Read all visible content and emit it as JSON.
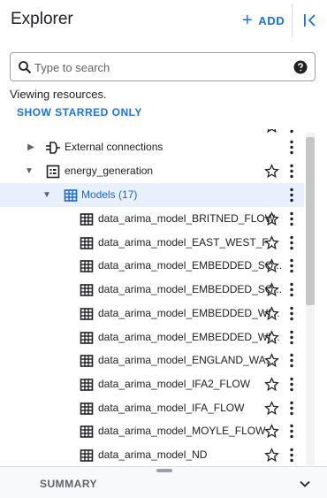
{
  "header": {
    "title": "Explorer",
    "add_label": "ADD"
  },
  "search": {
    "placeholder": "Type to search",
    "value": ""
  },
  "status_text": "Viewing resources.",
  "show_starred_label": "SHOW STARRED ONLY",
  "tree": {
    "external_connections": {
      "label": "External connections"
    },
    "dataset": {
      "label": "energy_generation"
    },
    "models_group": {
      "label": "Models (17)"
    },
    "models": [
      {
        "label": "data_arima_model_BRITNED_FLOW"
      },
      {
        "label": "data_arima_model_EAST_WEST_F..."
      },
      {
        "label": "data_arima_model_EMBEDDED_SO..."
      },
      {
        "label": "data_arima_model_EMBEDDED_SO..."
      },
      {
        "label": "data_arima_model_EMBEDDED_WI..."
      },
      {
        "label": "data_arima_model_EMBEDDED_WI..."
      },
      {
        "label": "data_arima_model_ENGLAND_WA..."
      },
      {
        "label": "data_arima_model_IFA2_FLOW"
      },
      {
        "label": "data_arima_model_IFA_FLOW"
      },
      {
        "label": "data_arima_model_MOYLE_FLOW"
      },
      {
        "label": "data_arima_model_ND"
      }
    ]
  },
  "summary": {
    "label": "SUMMARY"
  },
  "colors": {
    "accent": "#1a73e8",
    "selected_bg": "#e8f0fe",
    "text": "#202124",
    "muted": "#5f6368"
  },
  "icons": {
    "add": "plus-icon",
    "collapse": "collapse-panel-icon",
    "search": "search-icon",
    "help": "help-icon",
    "connection": "connection-icon",
    "dataset": "dataset-icon",
    "model": "model-icon",
    "star": "star-outline-icon",
    "menu": "more-vert-icon",
    "expand": "chevron-down-icon"
  }
}
